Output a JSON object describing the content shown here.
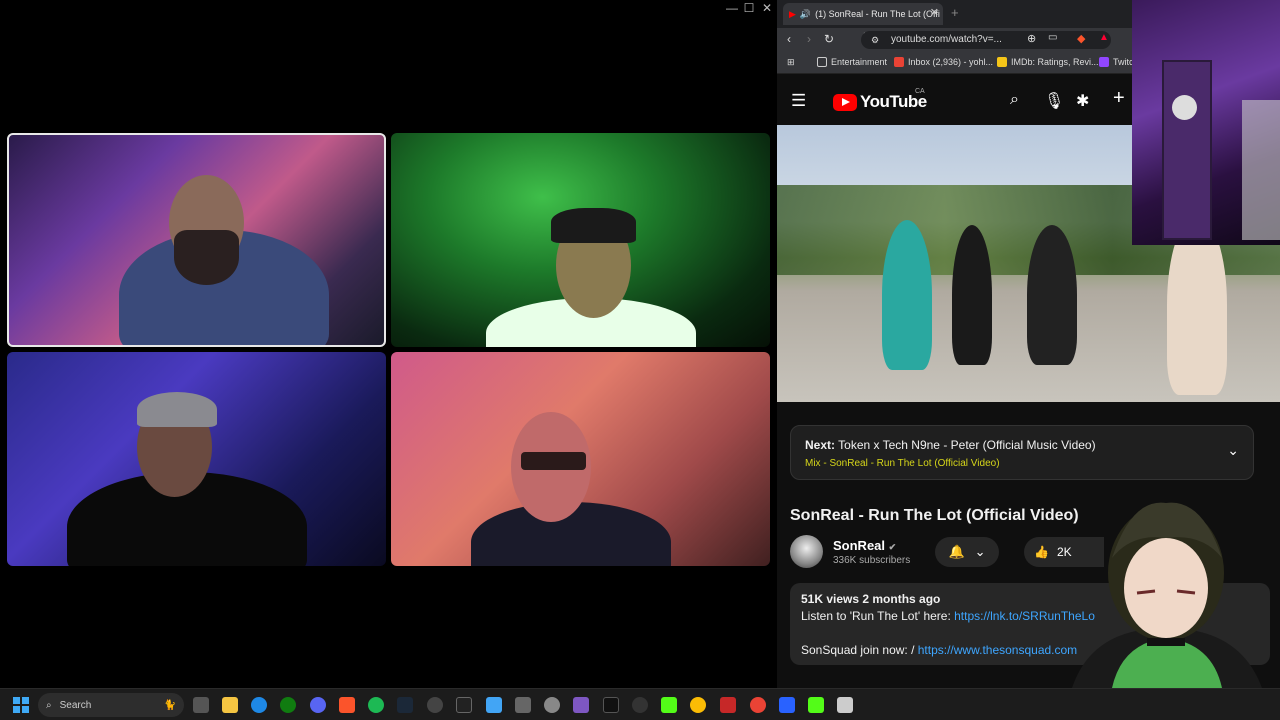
{
  "call_window": {
    "controls": {
      "minimize": "—",
      "maximize": "☐",
      "close": "✕"
    }
  },
  "browser": {
    "tab": {
      "title": "(1) SonReal - Run The Lot (Offi",
      "close": "✕",
      "new_tab": "+"
    },
    "url": "youtube.com/watch?v=...",
    "bookmarks": [
      {
        "label": "Entertainment",
        "icon": "folder-icon",
        "color": "#cccccc"
      },
      {
        "label": "Inbox (2,936) - yohl...",
        "icon": "gmail-icon",
        "color": "#ea4335"
      },
      {
        "label": "IMDb: Ratings, Revi...",
        "icon": "imdb-icon",
        "color": "#f5c518"
      },
      {
        "label": "Twitc",
        "icon": "twitch-icon",
        "color": "#9146ff"
      }
    ]
  },
  "youtube": {
    "logo_text": "YouTube",
    "country": "CA",
    "up_next": {
      "label": "Next:",
      "title": "Token x Tech N9ne - Peter (Official Music Video)",
      "subtitle": "Mix - SonReal - Run The Lot (Official Video)"
    },
    "video_title": "SonReal - Run The Lot (Official Video)",
    "channel": {
      "name": "SonReal",
      "subscribers": "336K subscribers"
    },
    "likes": "2K",
    "description": {
      "meta": "51K views  2 months ago",
      "line1_text": "Listen to 'Run The Lot' here: ",
      "line1_link": "https://lnk.to/SRRunTheLo",
      "line2_text": "SonSquad join now: / ",
      "line2_link": "https://www.thesonsquad.com"
    }
  },
  "taskbar": {
    "search_label": "Search"
  }
}
